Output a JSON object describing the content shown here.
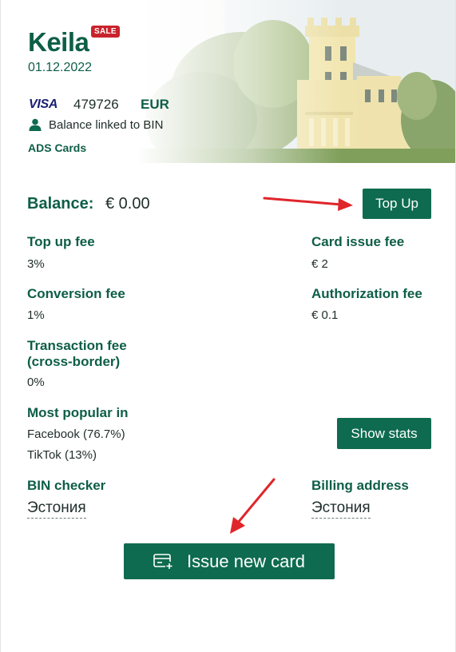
{
  "card": {
    "title": "Keila",
    "sale_badge": "SALE",
    "date": "01.12.2022",
    "network": "VISA",
    "bin": "479726",
    "currency": "EUR",
    "linked_text": "Balance linked to BIN",
    "provider": "ADS Cards"
  },
  "balance": {
    "label": "Balance:",
    "value": "€ 0.00",
    "top_up_label": "Top Up"
  },
  "fees": {
    "top_up_fee": {
      "label": "Top up fee",
      "value": "3%"
    },
    "card_issue_fee": {
      "label": "Card issue fee",
      "value": "€ 2"
    },
    "conversion_fee": {
      "label": "Conversion fee",
      "value": "1%"
    },
    "authorization_fee": {
      "label": "Authorization fee",
      "value": "€ 0.1"
    },
    "transaction_fee": {
      "label_line1": "Transaction fee",
      "label_line2": "(cross-border)",
      "value": "0%"
    }
  },
  "popular": {
    "label": "Most popular in",
    "items": [
      "Facebook (76.7%)",
      "TikTok (13%)"
    ],
    "show_stats_label": "Show stats"
  },
  "bin_checker": {
    "label": "BIN checker",
    "value": "Эстония"
  },
  "billing_address": {
    "label": "Billing address",
    "value": "Эстония"
  },
  "issue_button_label": "Issue new card",
  "colors": {
    "brand_green": "#0e6b4f",
    "label_green": "#0e5e47",
    "sale_red": "#c8232c",
    "annotation_arrow": "#e0252b"
  },
  "icons": [
    "user-icon",
    "card-plus-icon",
    "visa-logo"
  ]
}
